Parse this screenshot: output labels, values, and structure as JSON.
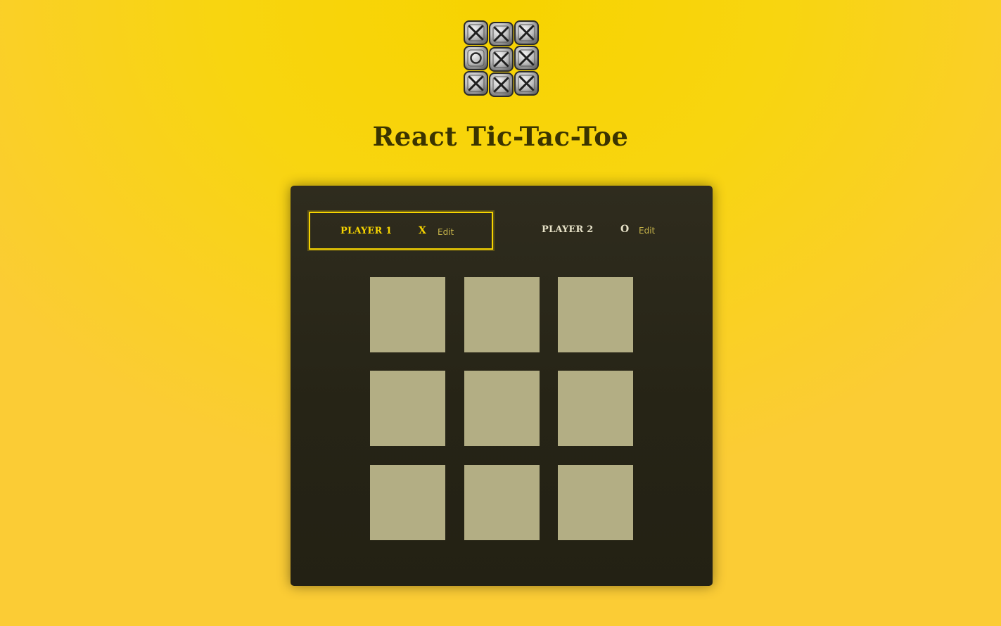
{
  "header": {
    "title": "React Tic-Tac-Toe",
    "logo": {
      "icon": "tic-tac-toe-logo-icon",
      "tiles": [
        "X",
        "X",
        "X",
        "O",
        "X",
        "X",
        "X",
        "X",
        "X"
      ]
    }
  },
  "players": [
    {
      "name": "PLAYER 1",
      "symbol": "X",
      "edit_label": "Edit",
      "active": true
    },
    {
      "name": "PLAYER 2",
      "symbol": "O",
      "edit_label": "Edit",
      "active": false
    }
  ],
  "board": {
    "rows": [
      [
        "",
        "",
        ""
      ],
      [
        "",
        "",
        ""
      ],
      [
        "",
        "",
        ""
      ]
    ]
  },
  "colors": {
    "background": "#f7d300",
    "title": "#3b3400",
    "panel": "#2a2719",
    "active_accent": "#f6d400",
    "cell": "#b3ae84",
    "edit_link": "#c8b54a"
  }
}
